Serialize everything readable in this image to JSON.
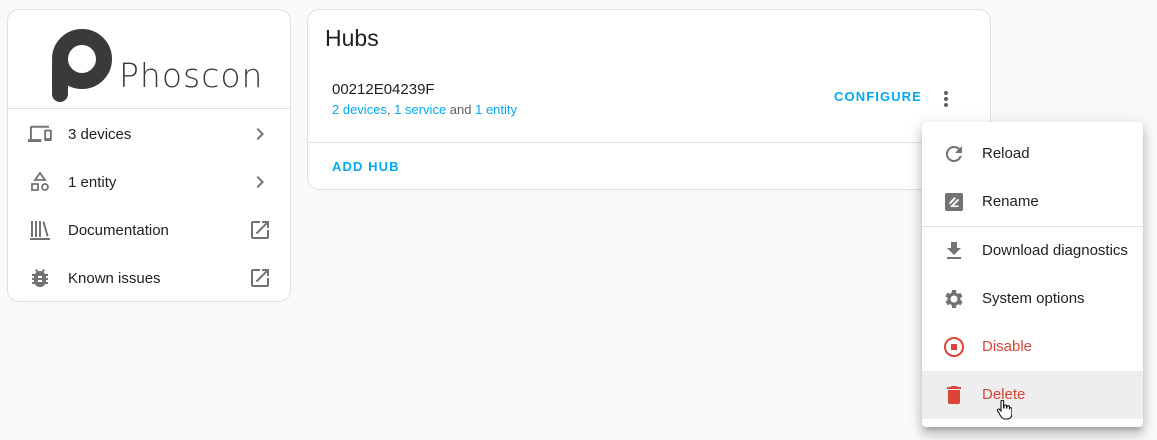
{
  "brand": {
    "name": "Phoscon"
  },
  "sidebar": {
    "items": [
      {
        "label": "3 devices",
        "icon": "devices-icon",
        "end_icon": "chevron-right-icon"
      },
      {
        "label": "1 entity",
        "icon": "shapes-icon",
        "end_icon": "chevron-right-icon"
      },
      {
        "label": "Documentation",
        "icon": "bookshelf-icon",
        "end_icon": "open-in-new-icon"
      },
      {
        "label": "Known issues",
        "icon": "bug-icon",
        "end_icon": "open-in-new-icon"
      }
    ]
  },
  "hubs": {
    "title": "Hubs",
    "entry": {
      "name": "00212E04239F",
      "devices_link": "2 devices",
      "sep1": ", ",
      "service_link": "1 service",
      "sep2": " and ",
      "entity_link": "1 entity",
      "configure_label": "CONFIGURE"
    },
    "add_hub_label": "ADD HUB"
  },
  "menu": {
    "items": [
      {
        "label": "Reload",
        "icon": "reload-icon"
      },
      {
        "label": "Rename",
        "icon": "rename-icon"
      },
      {
        "label": "Download diagnostics",
        "icon": "download-icon"
      },
      {
        "label": "System options",
        "icon": "gear-icon"
      },
      {
        "label": "Disable",
        "icon": "stop-circle-icon"
      },
      {
        "label": "Delete",
        "icon": "delete-icon"
      }
    ]
  },
  "colors": {
    "accent": "#03a9f4",
    "warning": "#db4437",
    "icon": "#727272"
  }
}
